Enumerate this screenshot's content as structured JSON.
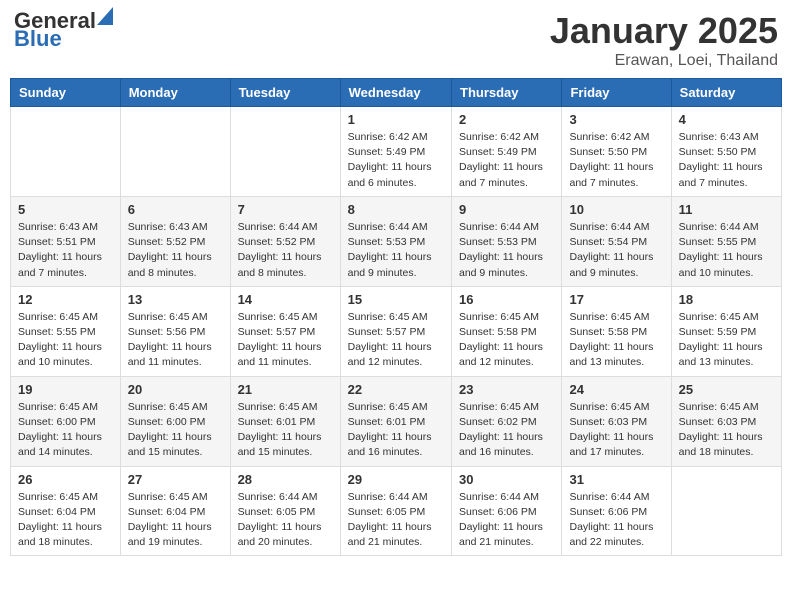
{
  "header": {
    "logo_general": "General",
    "logo_blue": "Blue",
    "title": "January 2025",
    "location": "Erawan, Loei, Thailand"
  },
  "days_of_week": [
    "Sunday",
    "Monday",
    "Tuesday",
    "Wednesday",
    "Thursday",
    "Friday",
    "Saturday"
  ],
  "weeks": [
    [
      {
        "day": "",
        "info": ""
      },
      {
        "day": "",
        "info": ""
      },
      {
        "day": "",
        "info": ""
      },
      {
        "day": "1",
        "info": "Sunrise: 6:42 AM\nSunset: 5:49 PM\nDaylight: 11 hours and 6 minutes."
      },
      {
        "day": "2",
        "info": "Sunrise: 6:42 AM\nSunset: 5:49 PM\nDaylight: 11 hours and 7 minutes."
      },
      {
        "day": "3",
        "info": "Sunrise: 6:42 AM\nSunset: 5:50 PM\nDaylight: 11 hours and 7 minutes."
      },
      {
        "day": "4",
        "info": "Sunrise: 6:43 AM\nSunset: 5:50 PM\nDaylight: 11 hours and 7 minutes."
      }
    ],
    [
      {
        "day": "5",
        "info": "Sunrise: 6:43 AM\nSunset: 5:51 PM\nDaylight: 11 hours and 7 minutes."
      },
      {
        "day": "6",
        "info": "Sunrise: 6:43 AM\nSunset: 5:52 PM\nDaylight: 11 hours and 8 minutes."
      },
      {
        "day": "7",
        "info": "Sunrise: 6:44 AM\nSunset: 5:52 PM\nDaylight: 11 hours and 8 minutes."
      },
      {
        "day": "8",
        "info": "Sunrise: 6:44 AM\nSunset: 5:53 PM\nDaylight: 11 hours and 9 minutes."
      },
      {
        "day": "9",
        "info": "Sunrise: 6:44 AM\nSunset: 5:53 PM\nDaylight: 11 hours and 9 minutes."
      },
      {
        "day": "10",
        "info": "Sunrise: 6:44 AM\nSunset: 5:54 PM\nDaylight: 11 hours and 9 minutes."
      },
      {
        "day": "11",
        "info": "Sunrise: 6:44 AM\nSunset: 5:55 PM\nDaylight: 11 hours and 10 minutes."
      }
    ],
    [
      {
        "day": "12",
        "info": "Sunrise: 6:45 AM\nSunset: 5:55 PM\nDaylight: 11 hours and 10 minutes."
      },
      {
        "day": "13",
        "info": "Sunrise: 6:45 AM\nSunset: 5:56 PM\nDaylight: 11 hours and 11 minutes."
      },
      {
        "day": "14",
        "info": "Sunrise: 6:45 AM\nSunset: 5:57 PM\nDaylight: 11 hours and 11 minutes."
      },
      {
        "day": "15",
        "info": "Sunrise: 6:45 AM\nSunset: 5:57 PM\nDaylight: 11 hours and 12 minutes."
      },
      {
        "day": "16",
        "info": "Sunrise: 6:45 AM\nSunset: 5:58 PM\nDaylight: 11 hours and 12 minutes."
      },
      {
        "day": "17",
        "info": "Sunrise: 6:45 AM\nSunset: 5:58 PM\nDaylight: 11 hours and 13 minutes."
      },
      {
        "day": "18",
        "info": "Sunrise: 6:45 AM\nSunset: 5:59 PM\nDaylight: 11 hours and 13 minutes."
      }
    ],
    [
      {
        "day": "19",
        "info": "Sunrise: 6:45 AM\nSunset: 6:00 PM\nDaylight: 11 hours and 14 minutes."
      },
      {
        "day": "20",
        "info": "Sunrise: 6:45 AM\nSunset: 6:00 PM\nDaylight: 11 hours and 15 minutes."
      },
      {
        "day": "21",
        "info": "Sunrise: 6:45 AM\nSunset: 6:01 PM\nDaylight: 11 hours and 15 minutes."
      },
      {
        "day": "22",
        "info": "Sunrise: 6:45 AM\nSunset: 6:01 PM\nDaylight: 11 hours and 16 minutes."
      },
      {
        "day": "23",
        "info": "Sunrise: 6:45 AM\nSunset: 6:02 PM\nDaylight: 11 hours and 16 minutes."
      },
      {
        "day": "24",
        "info": "Sunrise: 6:45 AM\nSunset: 6:03 PM\nDaylight: 11 hours and 17 minutes."
      },
      {
        "day": "25",
        "info": "Sunrise: 6:45 AM\nSunset: 6:03 PM\nDaylight: 11 hours and 18 minutes."
      }
    ],
    [
      {
        "day": "26",
        "info": "Sunrise: 6:45 AM\nSunset: 6:04 PM\nDaylight: 11 hours and 18 minutes."
      },
      {
        "day": "27",
        "info": "Sunrise: 6:45 AM\nSunset: 6:04 PM\nDaylight: 11 hours and 19 minutes."
      },
      {
        "day": "28",
        "info": "Sunrise: 6:44 AM\nSunset: 6:05 PM\nDaylight: 11 hours and 20 minutes."
      },
      {
        "day": "29",
        "info": "Sunrise: 6:44 AM\nSunset: 6:05 PM\nDaylight: 11 hours and 21 minutes."
      },
      {
        "day": "30",
        "info": "Sunrise: 6:44 AM\nSunset: 6:06 PM\nDaylight: 11 hours and 21 minutes."
      },
      {
        "day": "31",
        "info": "Sunrise: 6:44 AM\nSunset: 6:06 PM\nDaylight: 11 hours and 22 minutes."
      },
      {
        "day": "",
        "info": ""
      }
    ]
  ]
}
